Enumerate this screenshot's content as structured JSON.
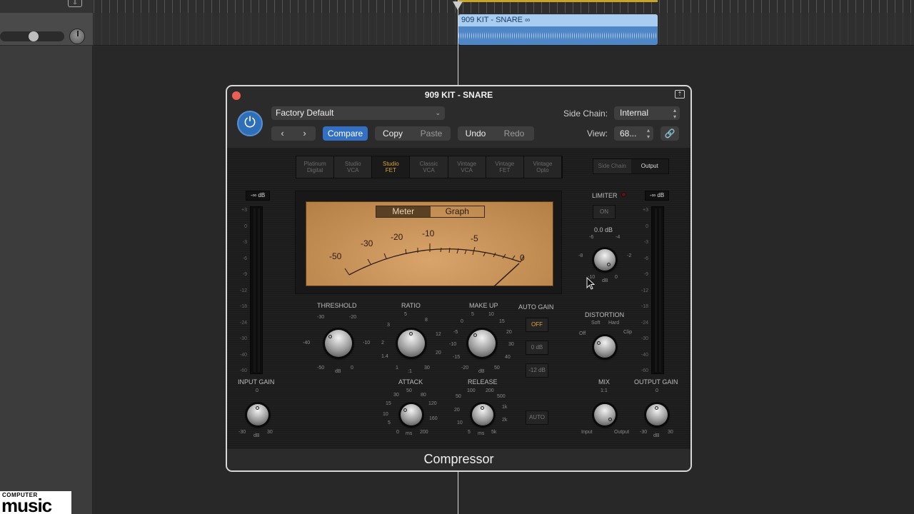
{
  "daw": {
    "region_name": "909 KIT - SNARE",
    "region_link_icon": "loop-link-icon"
  },
  "window": {
    "title": "909 KIT - SNARE",
    "plugin_name": "Compressor"
  },
  "toolbar": {
    "preset": "Factory Default",
    "prev_label": "‹",
    "next_label": "›",
    "compare": "Compare",
    "copy": "Copy",
    "paste": "Paste",
    "undo": "Undo",
    "redo": "Redo",
    "side_chain_label": "Side Chain:",
    "side_chain_value": "Internal",
    "view_label": "View:",
    "view_value": "68..."
  },
  "models": [
    {
      "line1": "Platinum",
      "line2": "Digital",
      "active": false
    },
    {
      "line1": "Studio",
      "line2": "VCA",
      "active": false
    },
    {
      "line1": "Studio",
      "line2": "FET",
      "active": true
    },
    {
      "line1": "Classic",
      "line2": "VCA",
      "active": false
    },
    {
      "line1": "Vintage",
      "line2": "VCA",
      "active": false
    },
    {
      "line1": "Vintage",
      "line2": "FET",
      "active": false
    },
    {
      "line1": "Vintage",
      "line2": "Opto",
      "active": false
    }
  ],
  "sidechain_output": {
    "side_chain": "Side Chain",
    "output": "Output",
    "active": "Output"
  },
  "meter": {
    "tabs": {
      "meter": "Meter",
      "graph": "Graph",
      "active": "Meter"
    },
    "scale": [
      "-50",
      "-30",
      "-20",
      "-10",
      "-5",
      "0"
    ]
  },
  "levels": {
    "input_readout": "-∞ dB",
    "output_readout": "-∞ dB",
    "scale": [
      "+3",
      "0",
      "-3",
      "-6",
      "-9",
      "-12",
      "-18",
      "-24",
      "-30",
      "-40",
      "-60"
    ]
  },
  "knobs": {
    "threshold": {
      "label": "THRESHOLD",
      "ticks": [
        "-30",
        "-20",
        "-40",
        "-10",
        "-50",
        "0"
      ],
      "unit": "dB"
    },
    "ratio": {
      "label": "RATIO",
      "ticks": [
        "5",
        "8",
        "3",
        "12",
        "2",
        "20",
        "1.4",
        "30",
        "1"
      ],
      "unit": ":1"
    },
    "makeup": {
      "label": "MAKE UP",
      "ticks": [
        "5",
        "10",
        "0",
        "15",
        "-5",
        "20",
        "-10",
        "30",
        "-15",
        "40",
        "-20",
        "50"
      ],
      "unit": "dB"
    },
    "attack": {
      "label": "ATTACK",
      "ticks": [
        "50",
        "30",
        "80",
        "15",
        "120",
        "10",
        "160",
        "5",
        "200",
        "0"
      ],
      "unit": "ms"
    },
    "release": {
      "label": "RELEASE",
      "ticks": [
        "100",
        "200",
        "50",
        "500",
        "20",
        "1k",
        "10",
        "2k",
        "5",
        "5k"
      ],
      "unit": "ms"
    },
    "input_gain": {
      "label": "INPUT GAIN",
      "ticks": [
        "0",
        "-30",
        "30"
      ],
      "unit": "dB"
    },
    "limiter": {
      "label": "LIMITER",
      "value": "0.0 dB",
      "ticks": [
        "-6",
        "-4",
        "-8",
        "-2",
        "-10",
        "0"
      ],
      "unit": "dB"
    },
    "distortion": {
      "label": "DISTORTION",
      "ticks": [
        "Soft",
        "Hard",
        "Off",
        "Clip"
      ]
    },
    "mix": {
      "label": "MIX",
      "ticks": [
        "1:1",
        "Input",
        "Output"
      ]
    },
    "output_gain": {
      "label": "OUTPUT GAIN",
      "ticks": [
        "0",
        "-30",
        "30"
      ],
      "unit": "dB"
    }
  },
  "auto_gain": {
    "label": "AUTO GAIN",
    "options": [
      "OFF",
      "0 dB",
      "-12 dB"
    ],
    "selected": "OFF",
    "auto_button": "AUTO"
  },
  "limiter_button": "ON",
  "watermark": {
    "top": "COMPUTER",
    "main": "music"
  }
}
